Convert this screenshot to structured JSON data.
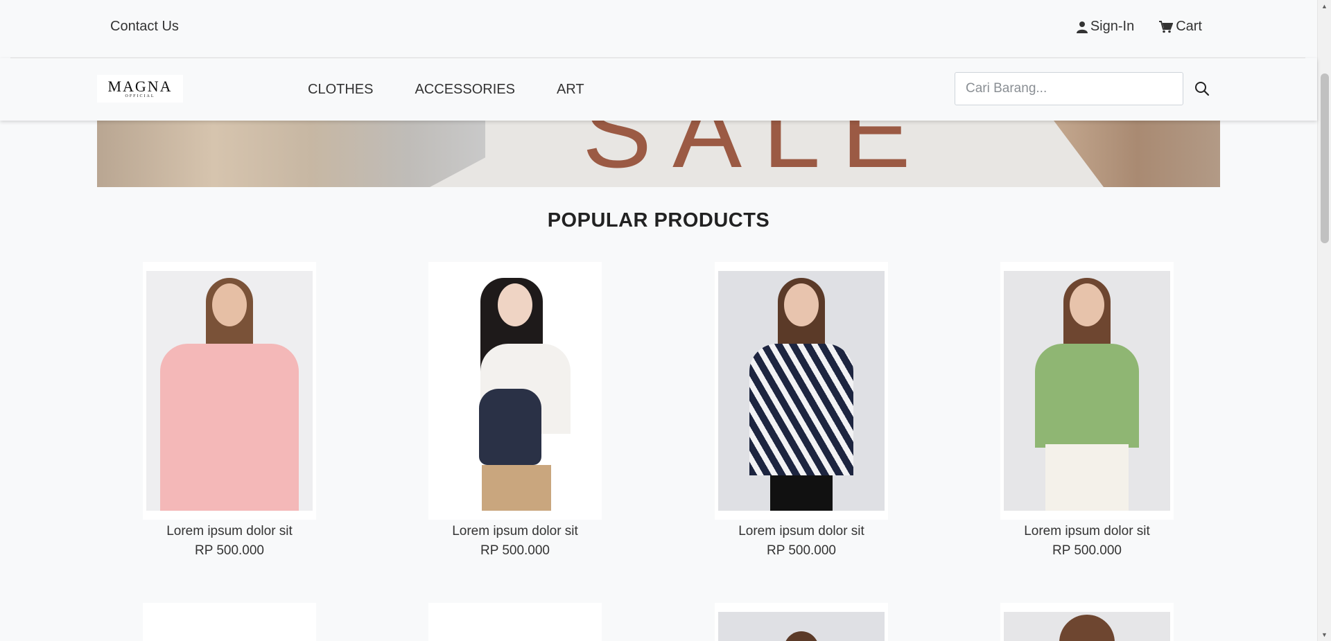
{
  "topbar": {
    "contact": "Contact Us",
    "signin": "Sign-In",
    "cart": "Cart"
  },
  "logo": {
    "name": "MAGNA",
    "sub": "OFFICIAL"
  },
  "nav": {
    "items": [
      "CLOTHES",
      "ACCESSORIES",
      "ART"
    ]
  },
  "search": {
    "placeholder": "Cari Barang..."
  },
  "banner": {
    "text": "SALE"
  },
  "section": {
    "title": "POPULAR PRODUCTS"
  },
  "products": [
    {
      "name": "Lorem ipsum dolor sit",
      "price": "RP 500.000"
    },
    {
      "name": "Lorem ipsum dolor sit",
      "price": "RP 500.000"
    },
    {
      "name": "Lorem ipsum dolor sit",
      "price": "RP 500.000"
    },
    {
      "name": "Lorem ipsum dolor sit",
      "price": "RP 500.000"
    }
  ]
}
